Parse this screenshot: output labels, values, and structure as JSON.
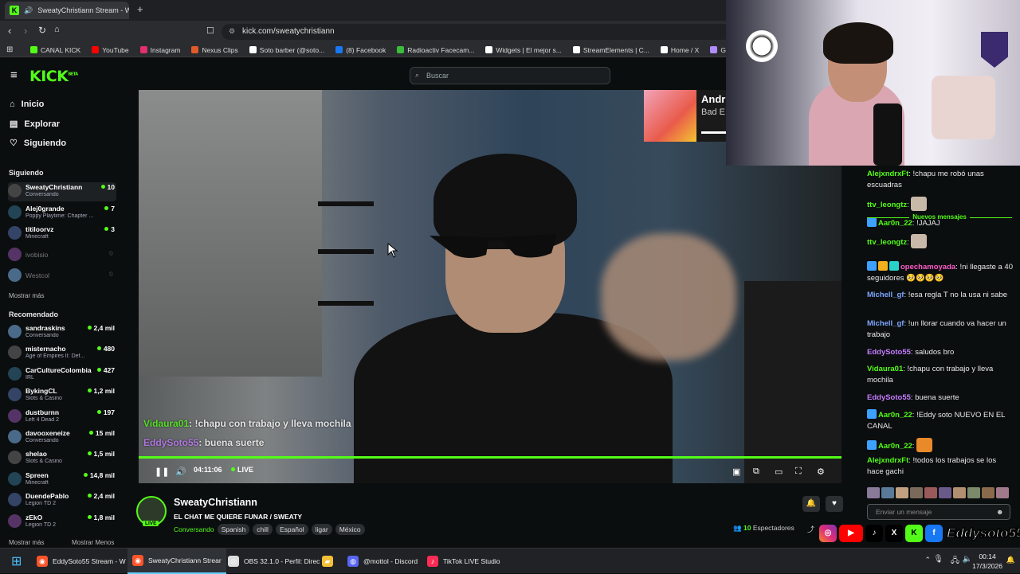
{
  "browser": {
    "tab_title": "SweatyChristiann Stream - W",
    "url": "kick.com/sweatychristiann",
    "bookmarks": [
      {
        "label": "CANAL KICK",
        "color": "#53fc18"
      },
      {
        "label": "YouTube",
        "color": "#ff0000"
      },
      {
        "label": "Instagram",
        "color": "#e1306c"
      },
      {
        "label": "Nexus Clips",
        "color": "#e05a2a"
      },
      {
        "label": "Soto barber (@soto...",
        "color": "#ffffff"
      },
      {
        "label": "(8) Facebook",
        "color": "#1877f2"
      },
      {
        "label": "Radioactiv Facecam...",
        "color": "#3cbc3c"
      },
      {
        "label": "Widgets | El mejor s...",
        "color": "#ffffff"
      },
      {
        "label": "StreamElements | C...",
        "color": "#ffffff"
      },
      {
        "label": "Home / X",
        "color": "#ffffff"
      },
      {
        "label": "Gartic Phone - Tele",
        "color": "#b18cff"
      }
    ]
  },
  "header": {
    "logo": "KICK",
    "logo_badge": "BETA",
    "search_placeholder": "Buscar"
  },
  "sidebar": {
    "nav": [
      {
        "label": "Inicio",
        "icon": "home-icon"
      },
      {
        "label": "Explorar",
        "icon": "explore-icon"
      },
      {
        "label": "Siguiendo",
        "icon": "heart-icon"
      }
    ],
    "following_title": "Siguiendo",
    "following": [
      {
        "name": "SweatyChristiann",
        "category": "Conversando",
        "viewers": "10",
        "online": true
      },
      {
        "name": "Alej0grande",
        "category": "Poppy Playtime: Chapter ...",
        "viewers": "7",
        "online": true
      },
      {
        "name": "titiloorvz",
        "category": "Minecraft",
        "viewers": "3",
        "online": true
      },
      {
        "name": "ivobisio",
        "category": "",
        "viewers": "",
        "online": false
      },
      {
        "name": "Westcol",
        "category": "",
        "viewers": "",
        "online": false
      }
    ],
    "show_more": "Mostrar más",
    "recommended_title": "Recomendado",
    "recommended": [
      {
        "name": "sandraskins",
        "category": "Conversando",
        "viewers": "2,4 mil"
      },
      {
        "name": "misternacho",
        "category": "Age of Empires II: Def...",
        "viewers": "480"
      },
      {
        "name": "CarCultureColombia",
        "category": "IRL",
        "viewers": "427"
      },
      {
        "name": "BykingCL",
        "category": "Slots & Casino",
        "viewers": "1,2 mil"
      },
      {
        "name": "dustburnn",
        "category": "Left 4 Dead 2",
        "viewers": "197"
      },
      {
        "name": "davooxeneize",
        "category": "Conversando",
        "viewers": "15 mil"
      },
      {
        "name": "shelao",
        "category": "Slots & Casino",
        "viewers": "1,5 mil"
      },
      {
        "name": "Spreen",
        "category": "Minecraft",
        "viewers": "14,8 mil"
      },
      {
        "name": "DuendePablo",
        "category": "Legion TD 2",
        "viewers": "2,4 mil"
      },
      {
        "name": "zEkO",
        "category": "Legion TD 2",
        "viewers": "1,8 mil"
      }
    ],
    "footer_more": "Mostrar más",
    "footer_less": "Mostrar Menos"
  },
  "video": {
    "overlay_chat": [
      {
        "user": "Vidaura01",
        "text": ": !chapu con trabajo y lleva mochila"
      },
      {
        "user": "EddySoto55",
        "text": ": buena suerte"
      }
    ],
    "time": "04:11:06",
    "live_label": "LIVE",
    "progress": 1.0,
    "album_title": "Andr",
    "album_sub": "Bad E"
  },
  "stream": {
    "name": "SweatyChristiann",
    "title": "EL CHAT ME QUIERE FUNAR / SWEATY",
    "category": "Conversando",
    "tags": [
      "Spanish",
      "chill",
      "Español",
      "ligar",
      "México"
    ],
    "viewers": "10",
    "viewers_label": "Espectadores",
    "live_badge": "LIVE"
  },
  "chat": {
    "messages": [
      {
        "user": "AlejxndrxFt",
        "color": "#53fc18",
        "text": "!chapu me robó unas escuadras"
      },
      {
        "user": "ttv_leongtz",
        "color": "#53fc18",
        "text": ""
      },
      {
        "user": "Aar0n_22",
        "color": "#53fc18",
        "text": "!JAJAJ"
      },
      {
        "user": "ttv_leongtz",
        "color": "#53fc18",
        "text": ""
      },
      {
        "user": "opechamoyada",
        "color": "#ff5ac8",
        "text": "!ni llegaste a 40 seguidores 🥺🥺🥺🥺"
      },
      {
        "user": "Michell_gf",
        "color": "#7fa6ff",
        "text": "!esa regla T no la usa ni sabe"
      },
      {
        "user": "Michell_gf",
        "color": "#7fa6ff",
        "text": "!un llorar cuando va hacer un trabajo"
      },
      {
        "user": "EddySoto55",
        "color": "#c47cff",
        "text": "saludos bro"
      },
      {
        "user": "Vidaura01",
        "color": "#53fc18",
        "text": "!chapu con trabajo y lleva mochila"
      },
      {
        "user": "EddySoto55",
        "color": "#c47cff",
        "text": "buena suerte"
      },
      {
        "user": "Aar0n_22",
        "color": "#53fc18",
        "text": "!Eddy soto NUEVO EN EL CANAL"
      },
      {
        "user": "Aar0n_22",
        "color": "#53fc18",
        "text": ""
      },
      {
        "user": "AlejxndrxFt",
        "color": "#53fc18",
        "text": "!todos los trabajos se los hace gachi"
      }
    ],
    "new_messages": "Nuevos mensajes",
    "input_placeholder": "Enviar un mensaje"
  },
  "overlay_handle": "Eddysoto55",
  "taskbar": {
    "items": [
      {
        "label": "EddySoto55 Stream - W",
        "color": "#fb542b"
      },
      {
        "label": "SweatyChristiann Strear",
        "color": "#fb542b"
      },
      {
        "label": "OBS 32.1.0 - Perfil: Direc",
        "color": "#dddddd"
      },
      {
        "label": "",
        "color": "#f2c037"
      },
      {
        "label": "@mottol - Discord",
        "color": "#5865f2"
      },
      {
        "label": "TikTok LIVE Studio",
        "color": "#fe2c55"
      }
    ],
    "time": "00:14",
    "date": "17/3/2026"
  }
}
